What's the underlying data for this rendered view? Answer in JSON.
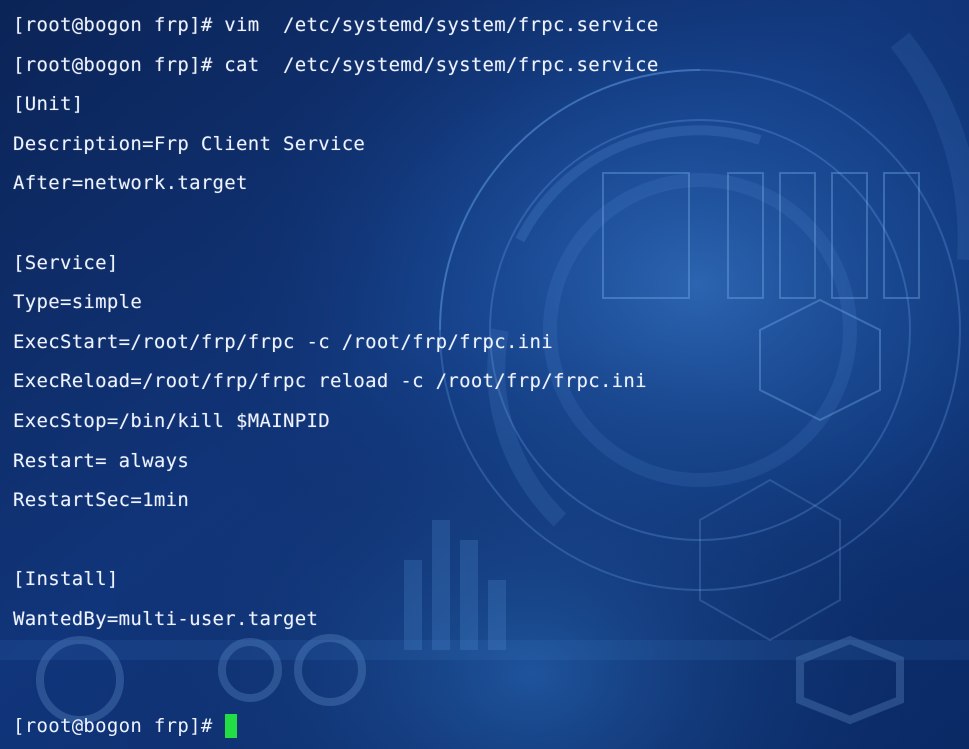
{
  "terminal": {
    "lines": [
      "[root@bogon frp]# vim  /etc/systemd/system/frpc.service",
      "[root@bogon frp]# cat  /etc/systemd/system/frpc.service",
      "[Unit]",
      "Description=Frp Client Service",
      "After=network.target",
      "",
      "[Service]",
      "Type=simple",
      "ExecStart=/root/frp/frpc -c /root/frp/frpc.ini",
      "ExecReload=/root/frp/frpc reload -c /root/frp/frpc.ini",
      "ExecStop=/bin/kill $MAINPID",
      "Restart= always",
      "RestartSec=1min",
      "",
      "[Install]",
      "WantedBy=multi-user.target",
      ""
    ],
    "prompt": "[root@bogon frp]#",
    "cursor_color": "#22dd44",
    "text_color": "#eef3ff",
    "background_color": "#0d2a5c"
  }
}
